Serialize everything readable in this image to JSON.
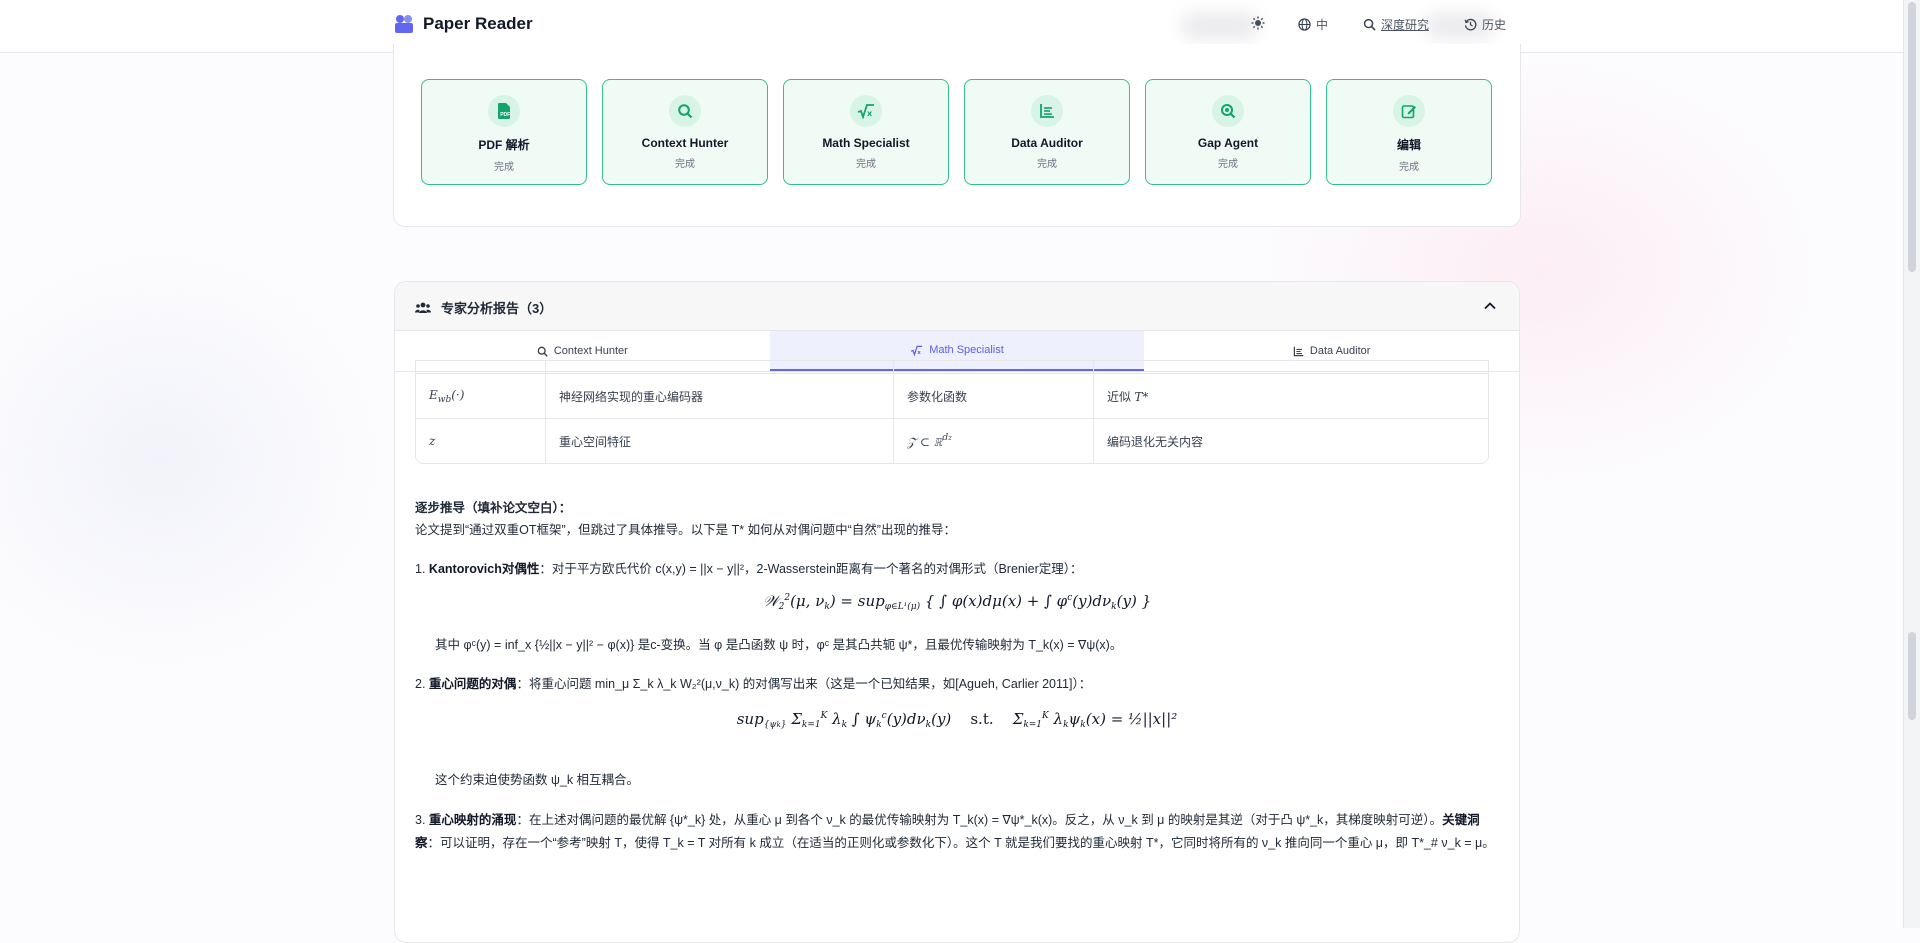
{
  "app": {
    "title": "Paper Reader"
  },
  "nav": {
    "lang": "中",
    "deep": "深度研究",
    "history": "历史"
  },
  "agents": [
    {
      "name": "PDF 解析",
      "status": "完成",
      "icon": "pdf-icon"
    },
    {
      "name": "Context Hunter",
      "status": "完成",
      "icon": "search-icon"
    },
    {
      "name": "Math Specialist",
      "status": "完成",
      "icon": "sqrt-icon"
    },
    {
      "name": "Data Auditor",
      "status": "完成",
      "icon": "chart-icon"
    },
    {
      "name": "Gap Agent",
      "status": "完成",
      "icon": "zoom-icon"
    },
    {
      "name": "编辑",
      "status": "完成",
      "icon": "edit-icon"
    }
  ],
  "report": {
    "title": "专家分析报告（3）",
    "tabs": [
      "Context Hunter",
      "Math Specialist",
      "Data Auditor"
    ],
    "active_tab": "Math Specialist",
    "table_rows": [
      {
        "sym": "E_wb(·)",
        "desc": "神经网络实现的重心编码器",
        "type": "参数化函数",
        "note": "近似 T*"
      },
      {
        "sym": "z",
        "desc": "重心空间特征",
        "type": "Z ⊂ ℝ^dz",
        "note": "编码退化无关内容"
      }
    ],
    "step_title": "逐步推导（填补论文空白）：",
    "intro": "论文提到“通过双重OT框架”，但跳过了具体推导。以下是 T* 如何从对偶问题中“自然”出现的推导：",
    "items": [
      {
        "num": "1.",
        "head": "Kantorovich对偶性",
        "text": "：对于平方欧氏代价 c(x,y) = ||x − y||²，2-Wasserstein距离有一个著名的对偶形式（Brenier定理）："
      },
      {
        "num": "2.",
        "head": "重心问题的对偶",
        "text": "：将重心问题 min_μ Σ_k λ_k W₂²(μ,ν_k) 的对偶写出来（这是一个已知结果，如[Agueh, Carlier 2011]）："
      },
      {
        "num": "3.",
        "head": "重心映射的涌现",
        "text": "：在上述对偶问题的最优解 {ψ*_k} 处，从重心 μ 到各个 ν_k 的最优传输映射为 T_k(x) = ∇ψ*_k(x)。反之，从 ν_k 到 μ 的映射是其逆（对于凸 ψ*_k，其梯度映射可逆）。"
      }
    ],
    "item1_after": "其中 φᶜ(y) = inf_x {½||x − y||² − φ(x)} 是c-变换。当 φ 是凸函数 ψ 时，φᶜ 是其凸共轭 ψ*，且最优传输映射为 T_k(x) = ∇ψ(x)。",
    "item2_after": "这个约束迫使势函数 ψ_k 相互耦合。",
    "item3_key": "关键洞察",
    "item3_rest": "：可以证明，存在一个“参考”映射 T，使得 T_k = T 对所有 k 成立（在适当的正则化或参数化下）。这个 T 就是我们要找的重心映射 T*，它同时将所有的 ν_k 推向同一个重心 μ，即 T*_# ν_k = μ。"
  },
  "colors": {
    "accent": "#6366f1",
    "success": "#34c08a"
  }
}
